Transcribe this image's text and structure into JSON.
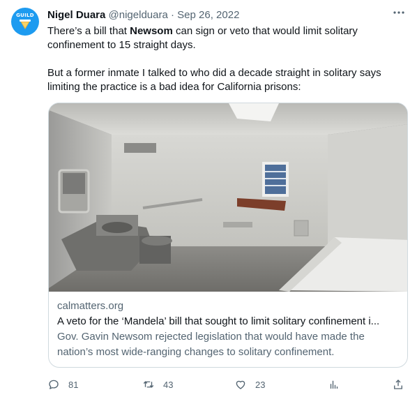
{
  "author": {
    "name": "Nigel Duara",
    "handle": "@nigelduara",
    "separator": "·",
    "date": "Sep 26, 2022",
    "avatar_label": "GUILD"
  },
  "tweet": {
    "line1_prefix": "There’s a bill that ",
    "line1_mention": "Newsom",
    "line1_suffix": " can sign or veto that would limit solitary confinement to 15 straight days.",
    "paragraph2": "But a former inmate I talked to who did a decade straight in solitary says limiting the practice is a bad idea for California prisons:"
  },
  "card": {
    "domain": "calmatters.org",
    "title": "A veto for the ‘Mandela’ bill that sought to limit solitary confinement i...",
    "description": "Gov. Gavin Newsom rejected legislation that would have made the nation’s most wide-ranging changes to solitary confinement."
  },
  "actions": {
    "replies": "81",
    "retweets": "43",
    "likes": "23"
  },
  "colors": {
    "text_primary": "#0f1419",
    "text_secondary": "#536471",
    "border": "#cfd9de",
    "avatar_bg": "#1d9bf0"
  },
  "icons": [
    "more-icon",
    "reply-icon",
    "retweet-icon",
    "like-icon",
    "analytics-icon",
    "share-icon"
  ]
}
